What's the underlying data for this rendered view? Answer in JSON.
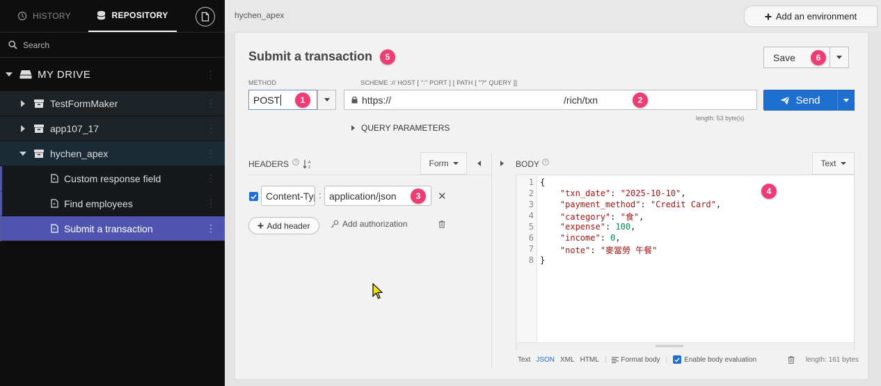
{
  "sidebar": {
    "tabs": [
      {
        "label": "HISTORY"
      },
      {
        "label": "REPOSITORY"
      }
    ],
    "search_placeholder": "Search",
    "drive_label": "MY DRIVE",
    "projects": [
      {
        "label": "TestFormMaker",
        "expanded": false
      },
      {
        "label": "app107_17",
        "expanded": false
      },
      {
        "label": "hychen_apex",
        "expanded": true
      }
    ],
    "requests": [
      {
        "label": "Custom response field"
      },
      {
        "label": "Find employees"
      },
      {
        "label": "Submit a transaction",
        "selected": true
      }
    ]
  },
  "topbar": {
    "breadcrumb": "hychen_apex",
    "add_environment": "Add an environment"
  },
  "request": {
    "title": "Submit a transaction",
    "save_label": "Save",
    "method_label": "METHOD",
    "method": "POST",
    "url_label": "SCHEME :// HOST [ \":\" PORT ] [ PATH [ \"?\" QUERY ]]",
    "url_prefix": "https://",
    "url_suffix": "/rich/txn",
    "url_length": "length: 53 byte(s)",
    "send_label": "Send",
    "query_parameters": "QUERY PARAMETERS"
  },
  "headers": {
    "label": "HEADERS",
    "mode": "Form",
    "rows": [
      {
        "enabled": true,
        "key": "Content-Type",
        "value": "application/json"
      }
    ],
    "add_header": "Add header",
    "add_authorization": "Add authorization"
  },
  "body": {
    "label": "BODY",
    "mode": "Text",
    "line_numbers": [
      "1",
      "2",
      "3",
      "4",
      "5",
      "6",
      "7",
      "8"
    ],
    "json": {
      "txn_date": "\"2025-10-10\"",
      "payment_method": "\"Credit Card\"",
      "category": "\"食\"",
      "expense": "100",
      "income": "0",
      "note": "\"麥當勞 午餐\""
    },
    "footer": {
      "formats": [
        "Text",
        "JSON",
        "XML",
        "HTML"
      ],
      "format_body": "Format body",
      "enable_eval": "Enable body evaluation",
      "length": "length: 161 bytes"
    }
  },
  "annotations": [
    "1",
    "2",
    "3",
    "4",
    "5",
    "6"
  ],
  "colors": {
    "accent": "#1f6fd1",
    "badge": "#ee3d74",
    "selected_item": "#4f55ae"
  }
}
